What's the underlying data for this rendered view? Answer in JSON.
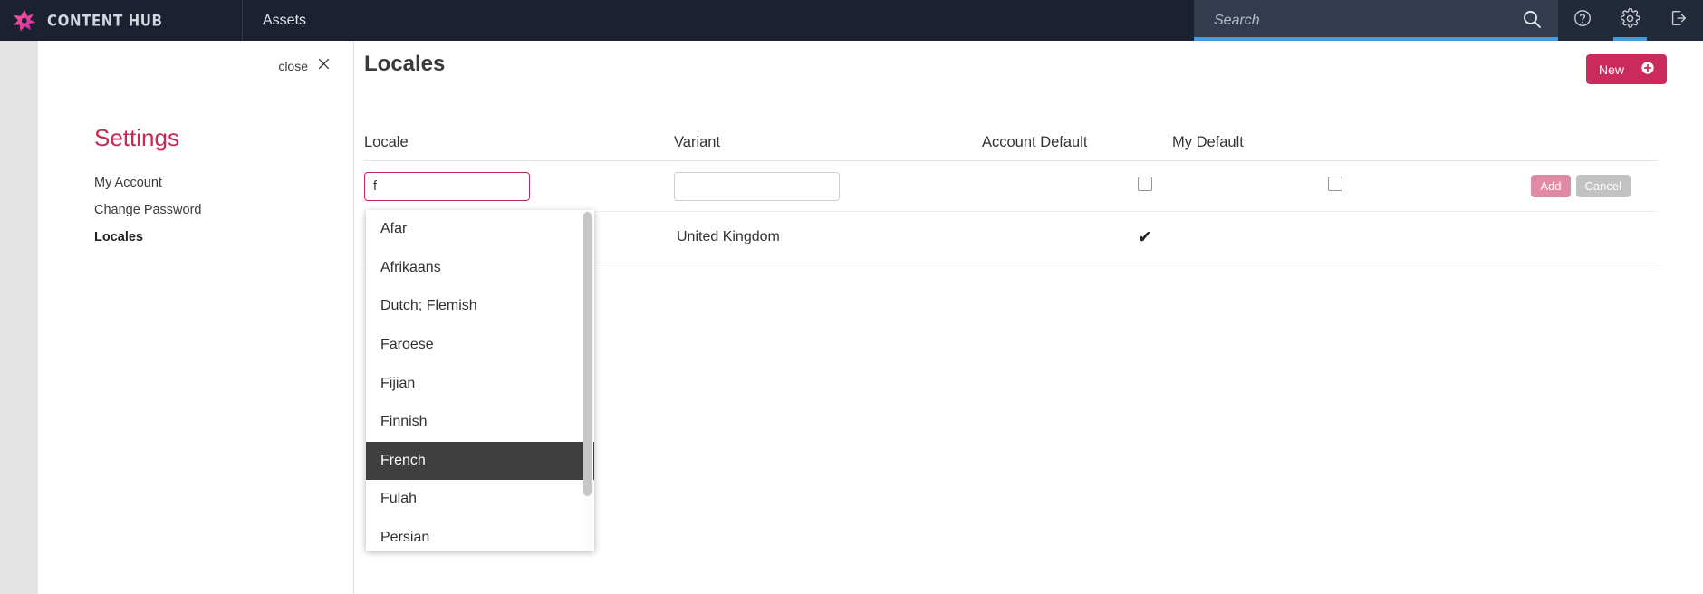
{
  "topbar": {
    "brand_name": "CONTENT HUB",
    "brand_logo_icon": "content-hub-burst-logo",
    "nav_tabs": [
      {
        "label": "Assets"
      }
    ],
    "search": {
      "value": "",
      "placeholder": "Search",
      "search_icon": "search-icon"
    },
    "icons": [
      {
        "name": "help-icon",
        "glyph": "?"
      },
      {
        "name": "gear-icon",
        "glyph": "gear"
      },
      {
        "name": "logout-icon",
        "glyph": "logout"
      }
    ],
    "accent_blue": "#3f9ce0",
    "background": "#1b2130"
  },
  "settings_panel": {
    "close_label": "close",
    "close_icon": "close-icon",
    "title": "Settings",
    "title_color": "#c42a54",
    "items": [
      {
        "label": "My Account",
        "active": false
      },
      {
        "label": "Change Password",
        "active": false
      },
      {
        "label": "Locales",
        "active": true
      }
    ]
  },
  "main": {
    "page_title": "Locales",
    "new_button": {
      "label": "New",
      "icon": "plus-circle-icon",
      "color": "#cb2a5d"
    },
    "table": {
      "columns": [
        "Locale",
        "Variant",
        "Account Default",
        "My Default"
      ],
      "edit_row": {
        "locale_value": "f",
        "locale_placeholder": "",
        "variant_value": "",
        "variant_placeholder": "",
        "account_default_checked": false,
        "my_default_checked": false,
        "add_label": "Add",
        "cancel_label": "Cancel"
      },
      "rows": [
        {
          "locale": "",
          "variant": "United Kingdom",
          "account_default": "✔",
          "my_default": ""
        }
      ]
    }
  },
  "dropdown": {
    "selected": "French",
    "items": [
      {
        "label": "Afar"
      },
      {
        "label": "Afrikaans"
      },
      {
        "label": "Dutch; Flemish"
      },
      {
        "label": "Faroese"
      },
      {
        "label": "Fijian"
      },
      {
        "label": "Finnish"
      },
      {
        "label": "French"
      },
      {
        "label": "Fulah"
      },
      {
        "label": "Persian"
      }
    ]
  }
}
